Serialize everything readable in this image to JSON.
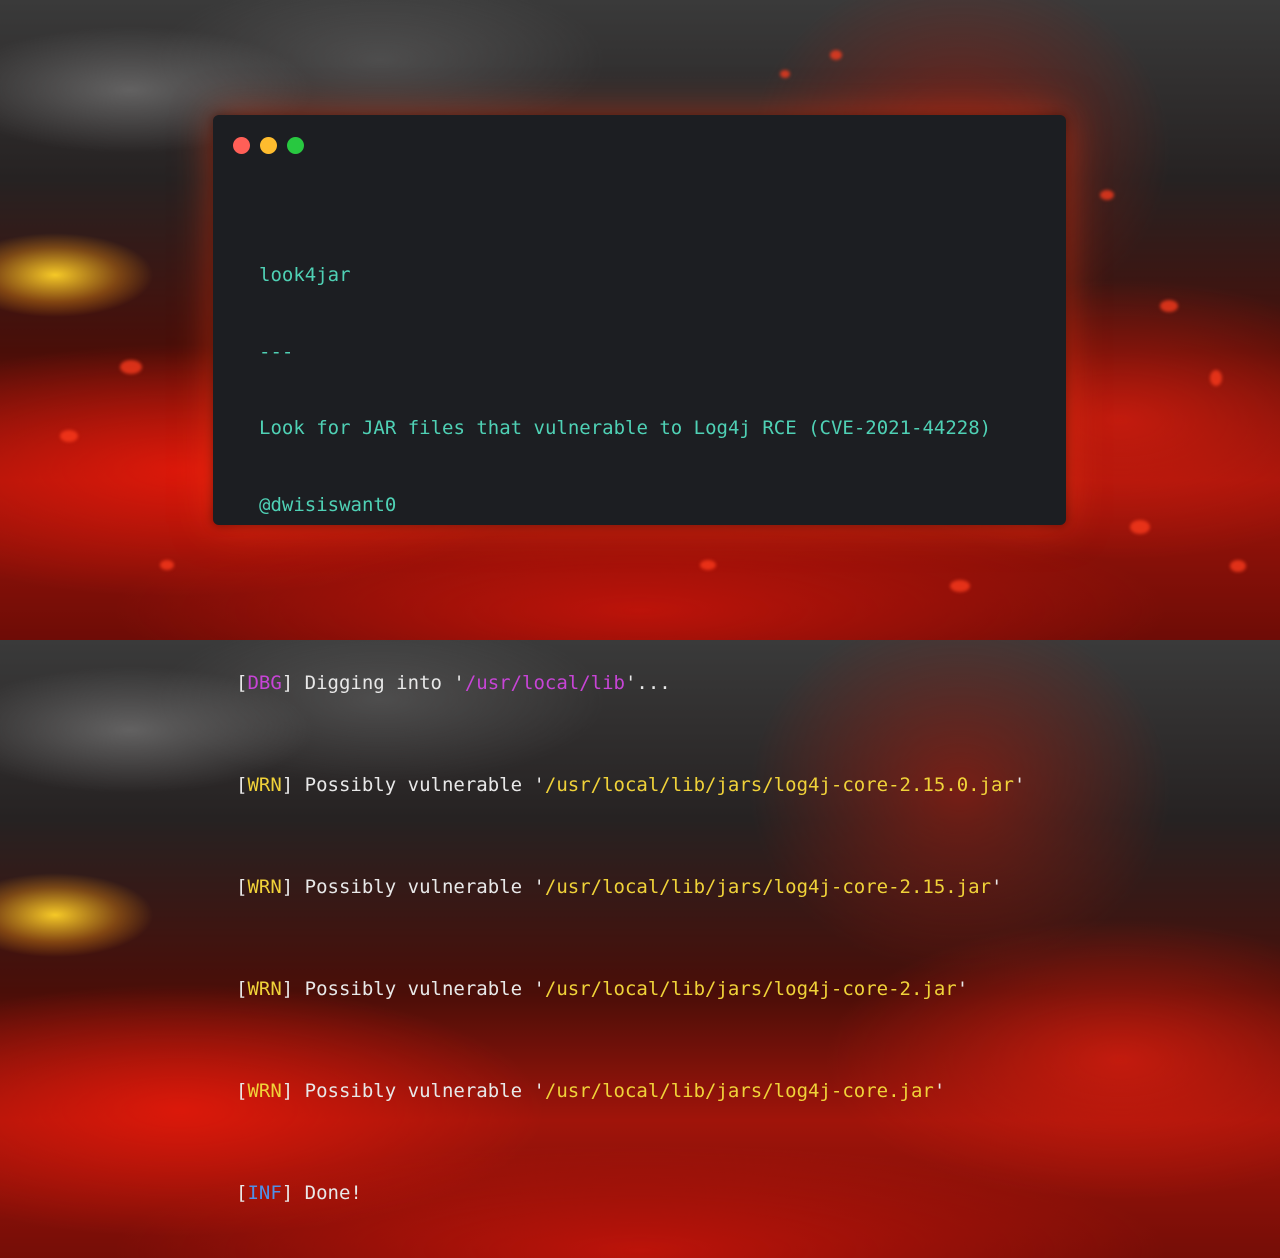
{
  "window": {
    "controls": [
      "close",
      "minimize",
      "maximize"
    ]
  },
  "banner": {
    "name": "look4jar",
    "separator": "---",
    "description": "Look for JAR files that vulnerable to Log4j RCE (CVE-2021-44228)",
    "author": "@dwisiswant0"
  },
  "log": {
    "dbg": {
      "level": "DBG",
      "message": " Digging into '",
      "path": "/usr/local/lib",
      "suffix": "'..."
    },
    "warnings": [
      {
        "level": "WRN",
        "message": " Possibly vulnerable '",
        "path": "/usr/local/lib/jars/log4j-core-2.15.0.jar",
        "suffix": "'"
      },
      {
        "level": "WRN",
        "message": " Possibly vulnerable '",
        "path": "/usr/local/lib/jars/log4j-core-2.15.jar",
        "suffix": "'"
      },
      {
        "level": "WRN",
        "message": " Possibly vulnerable '",
        "path": "/usr/local/lib/jars/log4j-core-2.jar",
        "suffix": "'"
      },
      {
        "level": "WRN",
        "message": " Possibly vulnerable '",
        "path": "/usr/local/lib/jars/log4j-core.jar",
        "suffix": "'"
      }
    ],
    "inf": {
      "level": "INF",
      "message": " Done!"
    }
  },
  "colors": {
    "banner": "#4fd1b5",
    "dbg": "#c744d6",
    "wrn": "#f0d239",
    "inf": "#4f8fe8",
    "text": "#e8e8e8",
    "terminal_bg": "#1c1e22"
  }
}
